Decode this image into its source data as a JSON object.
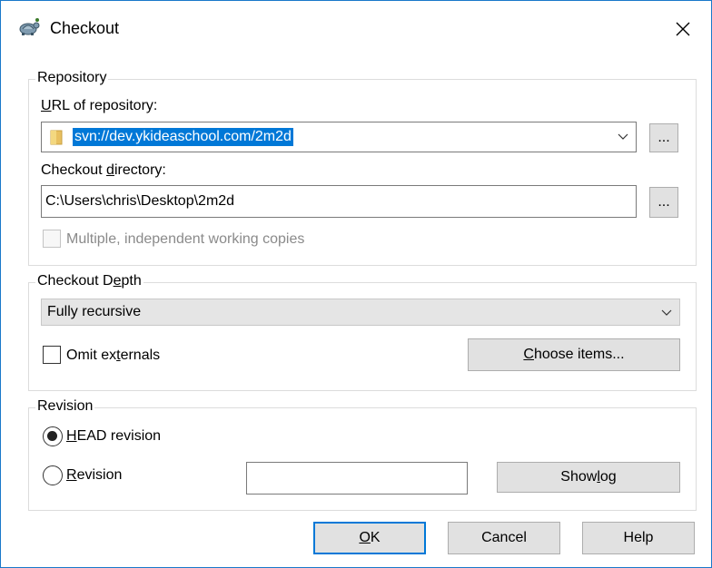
{
  "window": {
    "title": "Checkout"
  },
  "repository": {
    "group_label": "Repository",
    "url_label_u": "U",
    "url_label_rest": "RL of repository:",
    "url_value": "svn://dev.ykideaschool.com/2m2d",
    "browse_label": "...",
    "dir_label_pre": "Checkout ",
    "dir_label_u": "d",
    "dir_label_post": "irectory:",
    "dir_value": "C:\\Users\\chris\\Desktop\\2m2d",
    "multiple_label": "Multiple, independent working copies"
  },
  "depth": {
    "group_label_pre": "Checkout D",
    "group_label_u": "e",
    "group_label_post": "pth",
    "selected": "Fully recursive",
    "omit_pre": "Omit ex",
    "omit_u": "t",
    "omit_post": "ernals",
    "choose_u": "C",
    "choose_post": "hoose items..."
  },
  "revision": {
    "group_label": "Revision",
    "head_u": "H",
    "head_post": "EAD revision",
    "rev_u": "R",
    "rev_post": "evision",
    "rev_value": "",
    "showlog_pre": "Show ",
    "showlog_u": "l",
    "showlog_post": "og"
  },
  "footer": {
    "ok_u": "O",
    "ok_post": "K",
    "cancel": "Cancel",
    "help": "Help"
  },
  "colors": {
    "accent": "#0078d7",
    "selection": "#0078d7",
    "window_border": "#1979ca"
  }
}
